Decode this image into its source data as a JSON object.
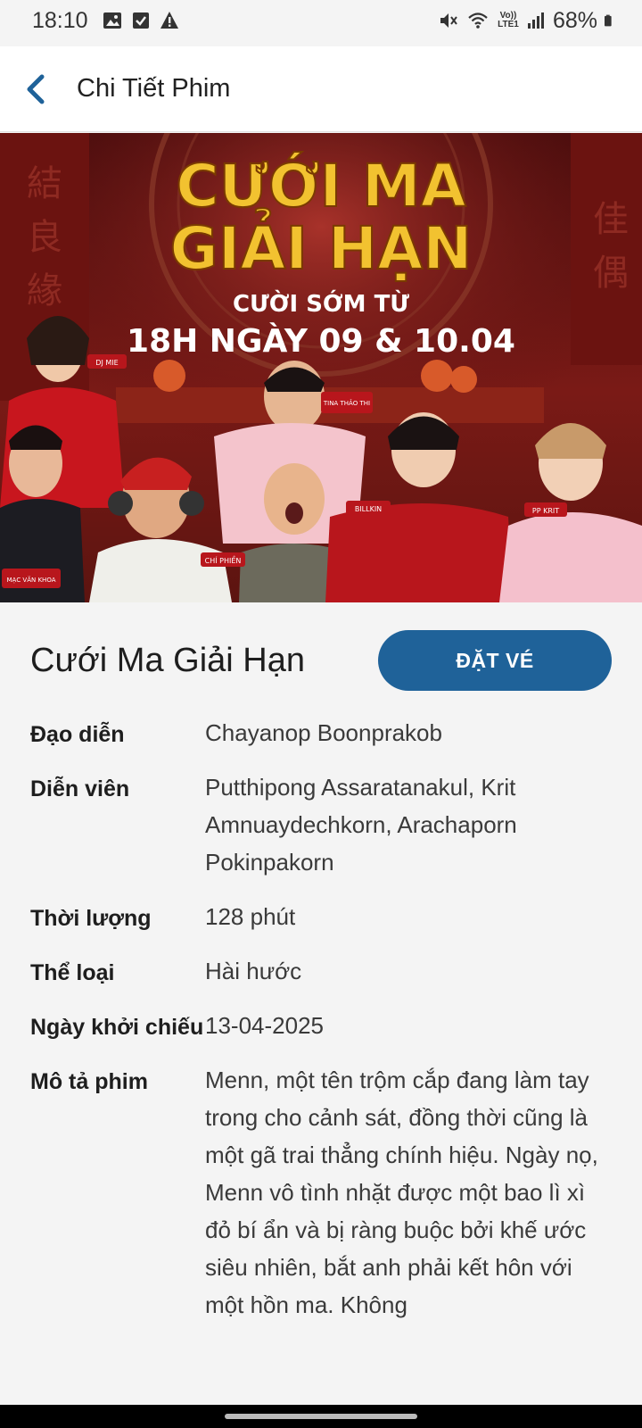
{
  "status_bar": {
    "time": "18:10",
    "battery": "68%",
    "left_icons": [
      "image-icon",
      "check-box-icon",
      "warning-icon"
    ],
    "right_icons": [
      "mute-icon",
      "wifi-icon",
      "volte-icon",
      "signal-icon",
      "battery-icon"
    ],
    "volte_label": "Vo)) LTE1"
  },
  "header": {
    "title": "Chi Tiết Phim",
    "back_icon": "chevron-left-icon"
  },
  "poster": {
    "title_line1": "CƯỚI MA",
    "title_line2": "GIẢI HẠN",
    "tagline": "CƯỜI SỚM TỪ",
    "dates": "18H NGÀY 09 & 10.04",
    "cast_tags": [
      "DJ MIE",
      "TINA THẢO THI",
      "BILLKIN",
      "PP KRIT",
      "MẠC VĂN KHOA",
      "CHÍ PHIỀN"
    ]
  },
  "movie": {
    "title": "Cưới Ma Giải Hạn",
    "book_label": "ĐẶT VÉ",
    "details": [
      {
        "label": "Đạo diễn",
        "value": "Chayanop Boonprakob"
      },
      {
        "label": "Diễn viên",
        "value": "Putthipong Assaratanakul, Krit Amnuaydechkorn, Arachaporn Pokinpakorn"
      },
      {
        "label": "Thời lượng",
        "value": "128 phút"
      },
      {
        "label": "Thể loại",
        "value": "Hài hước"
      },
      {
        "label": "Ngày khởi chiếu",
        "value": "13-04-2025"
      },
      {
        "label": "Mô tả phim",
        "value": "Menn, một tên trộm cắp đang làm tay trong cho cảnh sát, đồng thời cũng là một gã trai thẳng chính hiệu. Ngày nọ, Menn vô tình nhặt được một bao lì xì đỏ bí ẩn và bị ràng buộc bởi khế ước siêu nhiên, bắt anh phải kết hôn với một hồn ma. Không"
      }
    ]
  },
  "colors": {
    "accent": "#1f6299",
    "poster_gold": "#f2c230"
  }
}
